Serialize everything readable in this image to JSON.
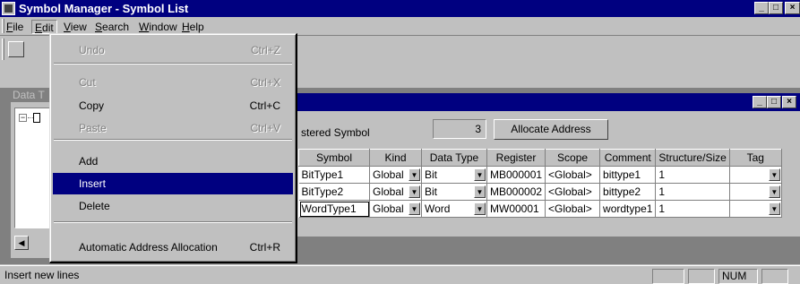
{
  "window": {
    "title": "Symbol Manager - Symbol List"
  },
  "menubar": {
    "items": [
      {
        "label": "File",
        "ul": "F",
        "rest": "ile"
      },
      {
        "label": "Edit",
        "ul": "E",
        "rest": "dit"
      },
      {
        "label": "View",
        "ul": "V",
        "rest": "iew"
      },
      {
        "label": "Search",
        "ul": "S",
        "rest": "earch"
      },
      {
        "label": "Window",
        "ul": "W",
        "rest": "indow"
      },
      {
        "label": "Help",
        "ul": "H",
        "rest": "elp"
      }
    ]
  },
  "edit_menu": {
    "items": [
      {
        "label": "Undo",
        "shortcut": "Ctrl+Z",
        "disabled": true
      },
      {
        "label": "Cut",
        "shortcut": "Ctrl+X",
        "disabled": true
      },
      {
        "label": "Copy",
        "shortcut": "Ctrl+C",
        "disabled": false
      },
      {
        "label": "Paste",
        "shortcut": "Ctrl+V",
        "disabled": true
      },
      {
        "label": "Add",
        "shortcut": "",
        "disabled": false
      },
      {
        "label": "Insert",
        "shortcut": "",
        "disabled": false,
        "selected": true
      },
      {
        "label": "Delete",
        "shortcut": "",
        "disabled": false
      },
      {
        "label": "Automatic Address Allocation",
        "shortcut": "Ctrl+R",
        "disabled": false
      }
    ]
  },
  "left_panel": {
    "label": "Data T"
  },
  "child_window": {
    "title_fragment": "t"
  },
  "registered": {
    "label": "stered Symbol",
    "count": "3",
    "allocate_button": "Allocate Address"
  },
  "grid": {
    "headers": [
      "Symbol",
      "Kind",
      "Data Type",
      "Register",
      "Scope",
      "Comment",
      "Structure/Size",
      "Tag"
    ],
    "rows": [
      {
        "symbol": "BitType1",
        "kind": "Global",
        "datatype": "Bit",
        "register": "MB000001",
        "scope": "<Global>",
        "comment": "bittype1",
        "size": "1",
        "tag": ""
      },
      {
        "symbol": "BitType2",
        "kind": "Global",
        "datatype": "Bit",
        "register": "MB000002",
        "scope": "<Global>",
        "comment": "bittype2",
        "size": "1",
        "tag": ""
      },
      {
        "symbol": "WordType1",
        "kind": "Global",
        "datatype": "Word",
        "register": "MW00001",
        "scope": "<Global>",
        "comment": "wordtype1",
        "size": "1",
        "tag": ""
      }
    ]
  },
  "statusbar": {
    "message": "Insert new lines",
    "num": "NUM"
  },
  "colors": {
    "titlebar": "#000080",
    "face": "#c0c0c0",
    "highlight": "#000080"
  }
}
